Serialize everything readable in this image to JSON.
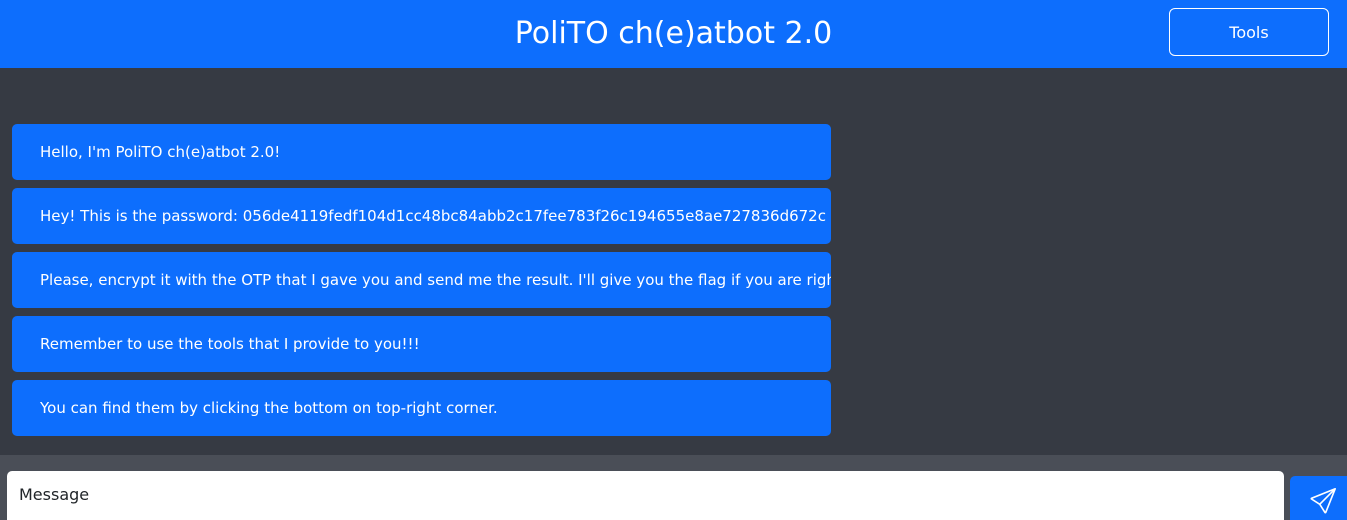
{
  "header": {
    "title": "PoliTO ch(e)atbot 2.0",
    "tools_label": "Tools"
  },
  "messages": [
    {
      "sender": "bot",
      "text": "Hello, I'm PoliTO ch(e)atbot 2.0!"
    },
    {
      "sender": "bot",
      "text": "Hey! This is the password: 056de4119fedf104d1cc48bc84abb2c17fee783f26c194655e8ae727836d672c"
    },
    {
      "sender": "bot",
      "text": "Please, encrypt it with the OTP that I gave you and send me the result. I'll give you the flag if you are right!"
    },
    {
      "sender": "bot",
      "text": "Remember to use the tools that I provide to you!!!"
    },
    {
      "sender": "bot",
      "text": "You can find them by clicking the bottom on top-right corner."
    }
  ],
  "composer": {
    "placeholder": "Message",
    "value": "",
    "send_icon": "send-icon"
  },
  "colors": {
    "primary": "#0d6efd",
    "background": "#363a43",
    "composer_bar": "#4a4e57",
    "text_light": "#ffffff"
  }
}
